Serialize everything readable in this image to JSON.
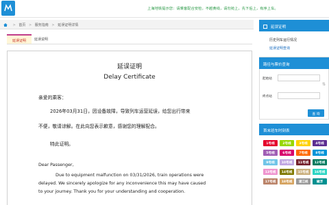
{
  "header": {
    "notice": "上海地铁提示您：请乘客配合安检，不越黄线，请勿抢上，先下后上，有序上车。"
  },
  "breadcrumb": {
    "items": [
      "首页",
      "服务指南",
      "延误证明详情"
    ]
  },
  "tabs": [
    {
      "label": "延误证明"
    },
    {
      "label": "延误说明"
    }
  ],
  "document": {
    "title_cn": "延误证明",
    "title_en": "Delay Certificate",
    "greeting_cn": "亲爱的乘客：",
    "body_cn_1": "2026年03月31日，因设备故障，导致列车运营延误，给您出行带来",
    "body_cn_2": "不便，敬请谅解。在此向您表示歉意，感谢您的理解配合。",
    "closing_cn": "特此证明。",
    "greeting_en": "Dear Passenger,",
    "body_en_1": "Due to equipment malfunction on 03/31/2026, train operations were",
    "body_en_2": "delayed. We sincerely apologize for any inconvenience this may have caused",
    "body_en_3": "to your journey. Thank you for your understanding and cooperation."
  },
  "sidebar": {
    "delay_section": {
      "title": "延误证明",
      "links": [
        "历史列车运行情况",
        "延误证明查询"
      ]
    },
    "route_section": {
      "title": "路径与票价查询",
      "from_label": "起始站",
      "to_label": "终点站",
      "from_value": "",
      "to_value": "",
      "query_button": "查 询"
    },
    "lines_section": {
      "title": "首末班车时刻表",
      "lines": [
        {
          "label": "1号线",
          "color": "#e4002b"
        },
        {
          "label": "2号线",
          "color": "#97d700"
        },
        {
          "label": "3号线",
          "color": "#ffd100"
        },
        {
          "label": "4号线",
          "color": "#5c2d91"
        },
        {
          "label": "5号线",
          "color": "#a05eb5"
        },
        {
          "label": "6号线",
          "color": "#d7006c"
        },
        {
          "label": "7号线",
          "color": "#ff6900"
        },
        {
          "label": "8号线",
          "color": "#0094d8"
        },
        {
          "label": "9号线",
          "color": "#71c5e8"
        },
        {
          "label": "10号线",
          "color": "#c1a7e2"
        },
        {
          "label": "11号线",
          "color": "#76232f"
        },
        {
          "label": "12号线",
          "color": "#007b5f"
        },
        {
          "label": "13号线",
          "color": "#ef95cf"
        },
        {
          "label": "14号线",
          "color": "#827a04"
        },
        {
          "label": "15号线",
          "color": "#cbb180"
        },
        {
          "label": "16号线",
          "color": "#2cd5c4"
        },
        {
          "label": "17号线",
          "color": "#bb846a"
        },
        {
          "label": "18号线",
          "color": "#d6a461"
        },
        {
          "label": "浦江线",
          "color": "#999999"
        },
        {
          "label": "磁浮",
          "color": "#009090"
        }
      ]
    }
  }
}
